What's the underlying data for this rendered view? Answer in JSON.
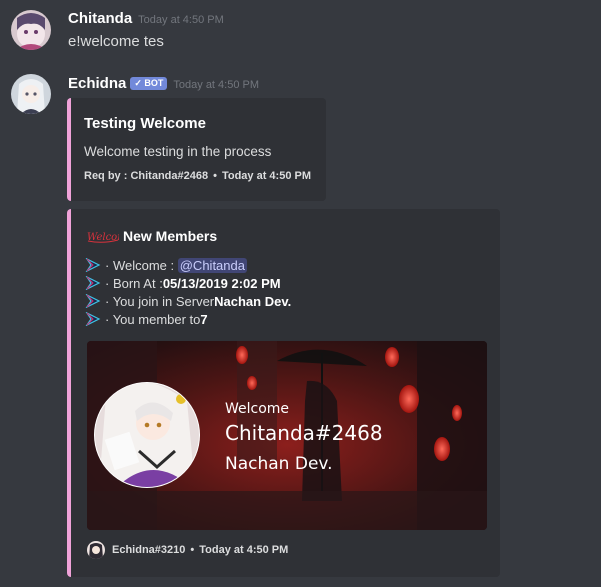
{
  "messages": [
    {
      "username": "Chitanda",
      "timestamp": "Today at 4:50 PM",
      "content": "e!welcome tes"
    },
    {
      "username": "Echidna",
      "bot_badge": "✓ BOT",
      "timestamp": "Today at 4:50 PM"
    }
  ],
  "embed1": {
    "title": "Testing Welcome",
    "description": "Welcome testing in the process",
    "footer_req": "Req by : Chitanda#2468",
    "footer_sep": "•",
    "footer_time": "Today at 4:50 PM"
  },
  "embed2": {
    "logo_text": "Welcome",
    "title": "New Members",
    "lines": [
      {
        "prefix": "· Welcome : ",
        "mention": "@Chitanda"
      },
      {
        "prefix": "· Born At : ",
        "bold": "05/13/2019 2:02 PM"
      },
      {
        "prefix": "· You join in Server ",
        "bold": "Nachan Dev."
      },
      {
        "prefix": "· You member to ",
        "bold": "7"
      }
    ],
    "card": {
      "welcome": "Welcome",
      "user": "Chitanda#2468",
      "server": "Nachan Dev."
    },
    "footer_name": "Echidna#3210",
    "footer_sep": "•",
    "footer_time": "Today at 4:50 PM"
  },
  "colors": {
    "background": "#36393f",
    "embed_bg": "#2f3136",
    "embed_border": "#f0a3d9",
    "bot_badge": "#7289da",
    "mention_bg": "#414675"
  }
}
